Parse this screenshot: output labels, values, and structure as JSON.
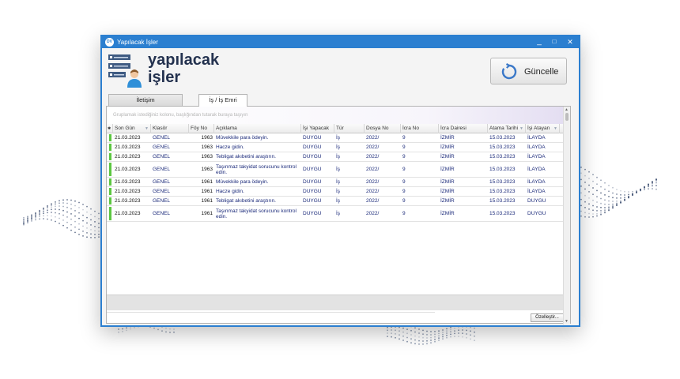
{
  "window": {
    "title": "Yapılacak İşler",
    "app_icon": "DV",
    "controls": {
      "minimize": "_",
      "maximize": "□",
      "close": "✕"
    }
  },
  "header": {
    "title_line1": "yapılacak",
    "title_line2": "işler",
    "icon": "task-list-person-icon",
    "refresh_label": "Güncelle",
    "refresh_icon": "refresh-icon"
  },
  "tabs": [
    {
      "label": "İletişim",
      "active": false
    },
    {
      "label": "İş / İş Emri",
      "active": true
    }
  ],
  "grid": {
    "group_panel_hint": "Gruplamak istediğiniz kolonu, başlığından tutarak buraya taşıyın",
    "columns": [
      {
        "key": "son_gun",
        "label": "Son Gün"
      },
      {
        "key": "klasor",
        "label": "Klasör"
      },
      {
        "key": "foy_no",
        "label": "Föy No"
      },
      {
        "key": "aciklama",
        "label": "Açıklama"
      },
      {
        "key": "isi_yapacak",
        "label": "İşi Yapacak"
      },
      {
        "key": "tur",
        "label": "Tür"
      },
      {
        "key": "dosya_no",
        "label": "Dosya No"
      },
      {
        "key": "icra_no",
        "label": "İcra No"
      },
      {
        "key": "icra_dairesi",
        "label": "İcra Dairesi"
      },
      {
        "key": "atama_tarihi",
        "label": "Atama Tarihi"
      },
      {
        "key": "isi_atayan",
        "label": "İşi Atayan"
      }
    ],
    "rows": [
      {
        "son_gun": "21.03.2023",
        "klasor": "GENEL",
        "foy_no": "1963",
        "aciklama": "Müvekkile para ödeyin.",
        "isi_yapacak": "DUYGU",
        "tur": "İş",
        "dosya_no": "2022/",
        "icra_no": "9",
        "icra_dairesi": "İZMİR",
        "atama_tarihi": "15.03.2023",
        "isi_atayan": "İLAYDA",
        "tall": false
      },
      {
        "son_gun": "21.03.2023",
        "klasor": "GENEL",
        "foy_no": "1963",
        "aciklama": "Hacze gidin.",
        "isi_yapacak": "DUYGU",
        "tur": "İş",
        "dosya_no": "2022/",
        "icra_no": "9",
        "icra_dairesi": "İZMİR",
        "atama_tarihi": "15.03.2023",
        "isi_atayan": "İLAYDA",
        "tall": false
      },
      {
        "son_gun": "21.03.2023",
        "klasor": "GENEL",
        "foy_no": "1963",
        "aciklama": "Tebligat akıbetini araştırın.",
        "isi_yapacak": "DUYGU",
        "tur": "İş",
        "dosya_no": "2022/",
        "icra_no": "9",
        "icra_dairesi": "İZMİR",
        "atama_tarihi": "15.03.2023",
        "isi_atayan": "İLAYDA",
        "tall": false
      },
      {
        "son_gun": "21.03.2023",
        "klasor": "GENEL",
        "foy_no": "1963",
        "aciklama": "Taşınmaz takyidat sorucunu kontrol edin.",
        "isi_yapacak": "DUYGU",
        "tur": "İş",
        "dosya_no": "2022/",
        "icra_no": "9",
        "icra_dairesi": "İZMİR",
        "atama_tarihi": "15.03.2023",
        "isi_atayan": "İLAYDA",
        "tall": true
      },
      {
        "son_gun": "21.03.2023",
        "klasor": "GENEL",
        "foy_no": "1961",
        "aciklama": "Müvekkile para ödeyin.",
        "isi_yapacak": "DUYGU",
        "tur": "İş",
        "dosya_no": "2022/",
        "icra_no": "9",
        "icra_dairesi": "İZMİR",
        "atama_tarihi": "15.03.2023",
        "isi_atayan": "İLAYDA",
        "tall": false
      },
      {
        "son_gun": "21.03.2023",
        "klasor": "GENEL",
        "foy_no": "1961",
        "aciklama": "Hacze gidin.",
        "isi_yapacak": "DUYGU",
        "tur": "İş",
        "dosya_no": "2022/",
        "icra_no": "9",
        "icra_dairesi": "İZMİR",
        "atama_tarihi": "15.03.2023",
        "isi_atayan": "İLAYDA",
        "tall": false
      },
      {
        "son_gun": "21.03.2023",
        "klasor": "GENEL",
        "foy_no": "1961",
        "aciklama": "Tebligat akıbetini araştırın.",
        "isi_yapacak": "DUYGU",
        "tur": "İş",
        "dosya_no": "2022/",
        "icra_no": "9",
        "icra_dairesi": "İZMİR",
        "atama_tarihi": "15.03.2023",
        "isi_atayan": "DUYGU",
        "tall": false
      },
      {
        "son_gun": "21.03.2023",
        "klasor": "GENEL",
        "foy_no": "1961",
        "aciklama": "Taşınmaz takyidat sorucunu kontrol edin.",
        "isi_yapacak": "DUYGU",
        "tur": "İş",
        "dosya_no": "2022/",
        "icra_no": "9",
        "icra_dairesi": "İZMİR",
        "atama_tarihi": "15.03.2023",
        "isi_atayan": "DUYGU",
        "tall": true
      }
    ],
    "customize_label": "Özelleştir..."
  },
  "colors": {
    "title_bar": "#2b7fd0",
    "status_green": "#5cc640",
    "row_text": "#1b2a7a",
    "header_title": "#24324f"
  }
}
